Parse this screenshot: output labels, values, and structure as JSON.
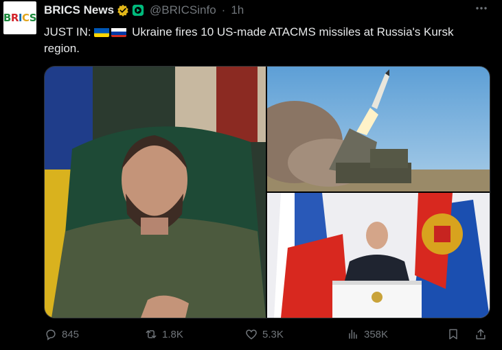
{
  "post": {
    "avatar_text": "BRICS",
    "author_name": "BRICS News",
    "handle": "@BRICSinfo",
    "separator": "·",
    "time": "1h",
    "text_prefix": "JUST IN:",
    "text_main": "Ukraine fires 10 US-made ATACMS missiles at Russia's Kursk region.",
    "flags": [
      "ukraine-flag",
      "russia-flag"
    ],
    "media": [
      {
        "name": "photo-zelensky",
        "description": "man in olive t-shirt seated in green chair"
      },
      {
        "name": "photo-missile-launch",
        "description": "missile launched from tracked vehicle"
      },
      {
        "name": "photo-putin-podium",
        "description": "man speaking at podium between flags"
      }
    ]
  },
  "actions": {
    "replies": "845",
    "reposts": "1.8K",
    "likes": "5.3K",
    "views": "358K"
  },
  "colors": {
    "background": "#000000",
    "text": "#e7e9ea",
    "muted": "#71767b",
    "verified_gold": "#e2b719",
    "affiliate_green": "#00ba7c"
  }
}
